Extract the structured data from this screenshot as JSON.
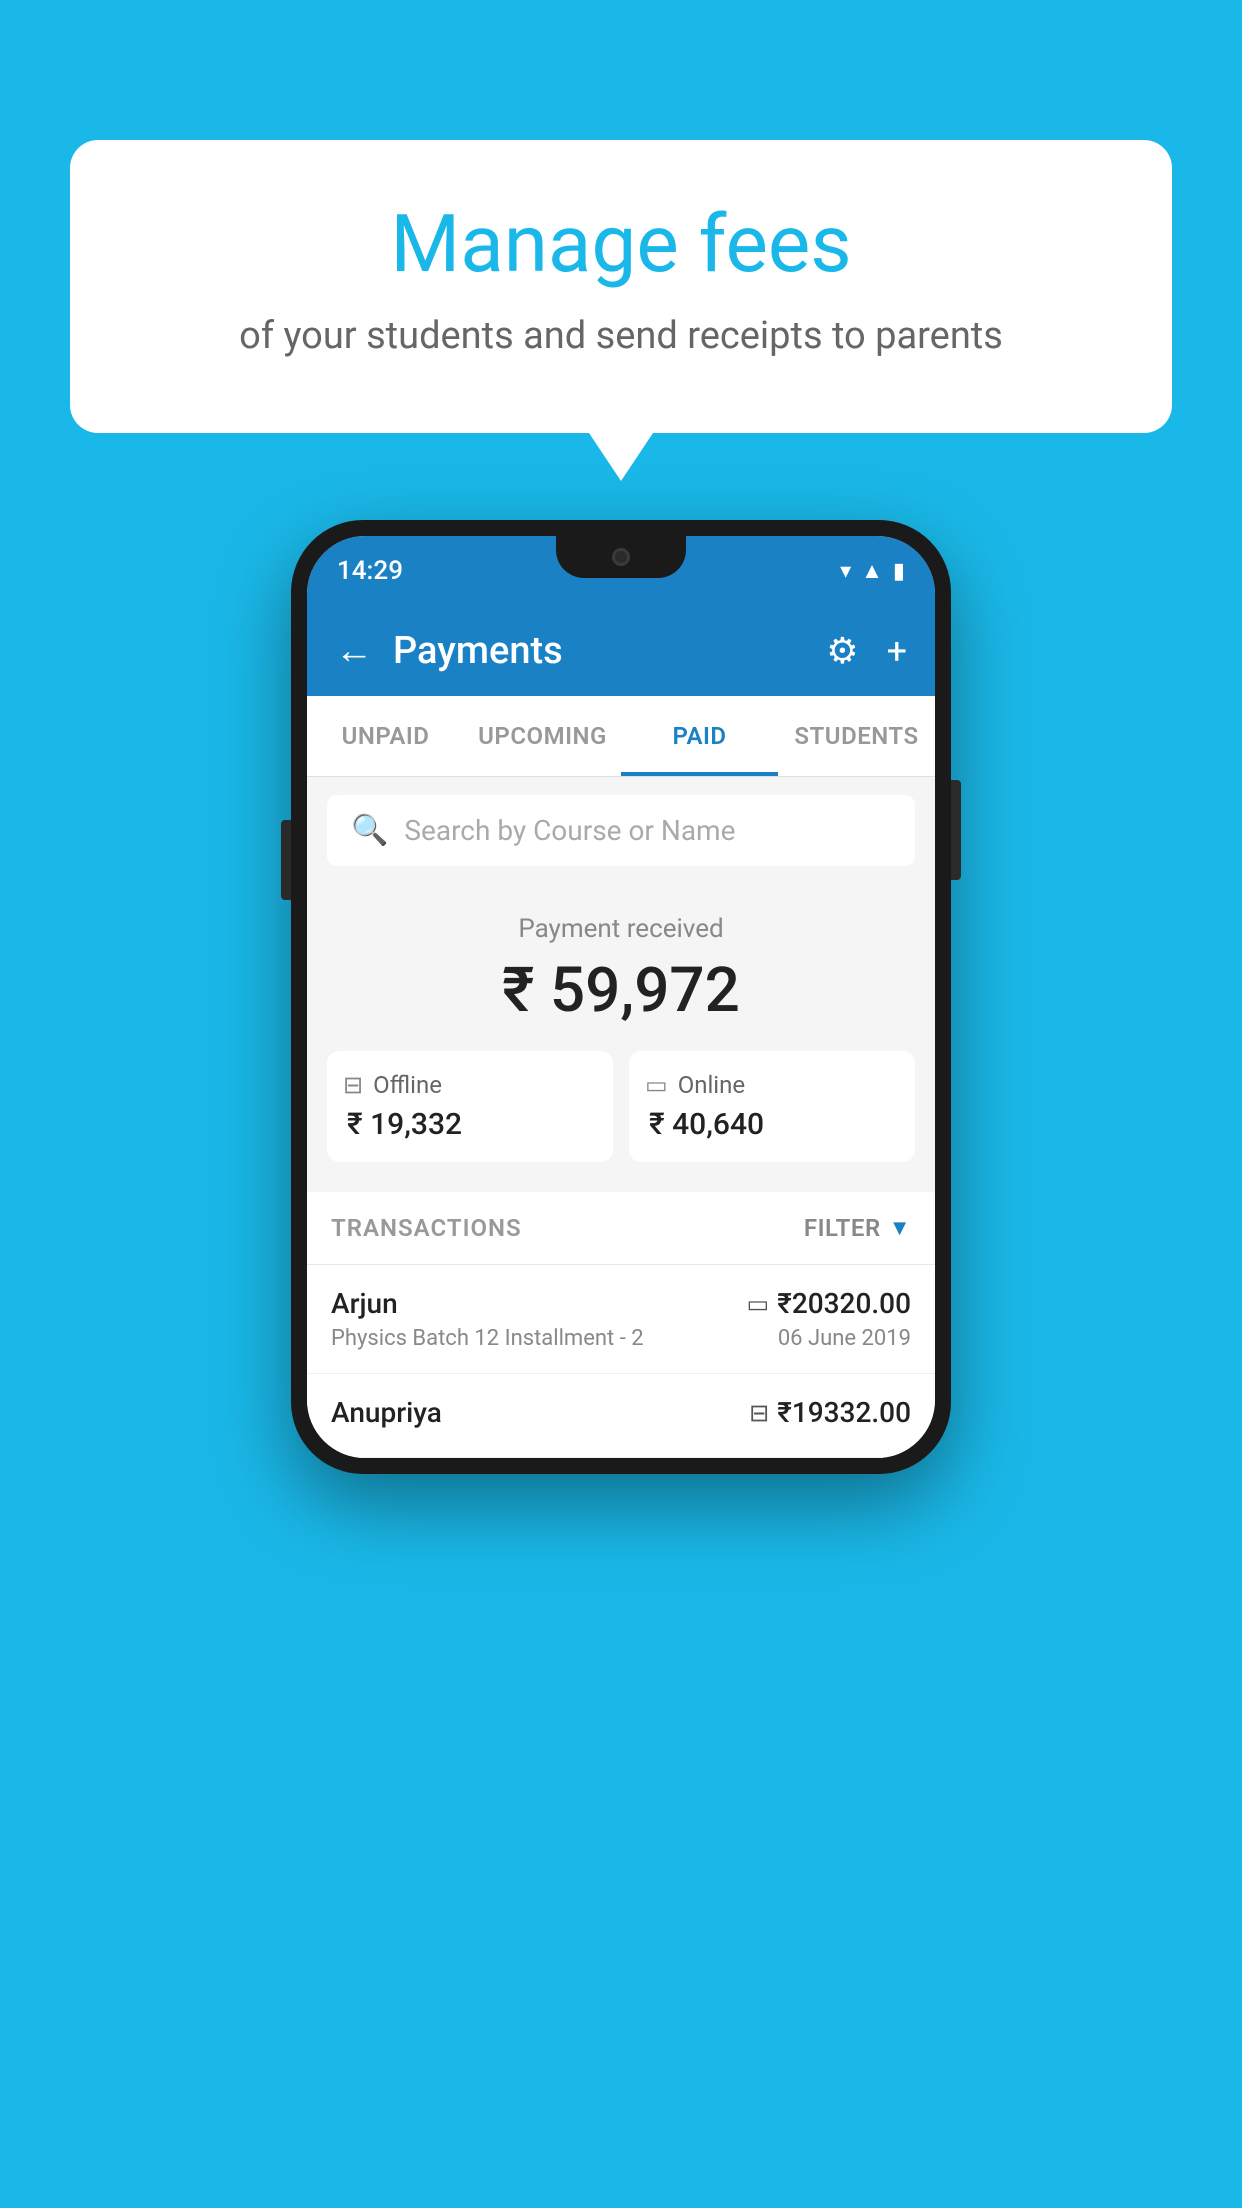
{
  "background_color": "#1ab8e8",
  "bubble": {
    "title": "Manage fees",
    "subtitle": "of your students and send receipts to parents"
  },
  "phone": {
    "status_bar": {
      "time": "14:29",
      "icons": [
        "wifi",
        "signal",
        "battery"
      ]
    },
    "header": {
      "back_label": "←",
      "title": "Payments",
      "settings_icon": "gear",
      "add_icon": "+"
    },
    "tabs": [
      {
        "label": "UNPAID",
        "active": false
      },
      {
        "label": "UPCOMING",
        "active": false
      },
      {
        "label": "PAID",
        "active": true
      },
      {
        "label": "STUDENTS",
        "active": false
      }
    ],
    "search": {
      "placeholder": "Search by Course or Name"
    },
    "payment_summary": {
      "label": "Payment received",
      "amount": "₹ 59,972",
      "offline": {
        "label": "Offline",
        "amount": "₹ 19,332"
      },
      "online": {
        "label": "Online",
        "amount": "₹ 40,640"
      }
    },
    "transactions": {
      "label": "TRANSACTIONS",
      "filter_label": "FILTER",
      "rows": [
        {
          "name": "Arjun",
          "amount": "₹20320.00",
          "desc": "Physics Batch 12 Installment - 2",
          "date": "06 June 2019",
          "payment_type": "card"
        },
        {
          "name": "Anupriya",
          "amount": "₹19332.00",
          "desc": "",
          "date": "",
          "payment_type": "cash"
        }
      ]
    }
  }
}
